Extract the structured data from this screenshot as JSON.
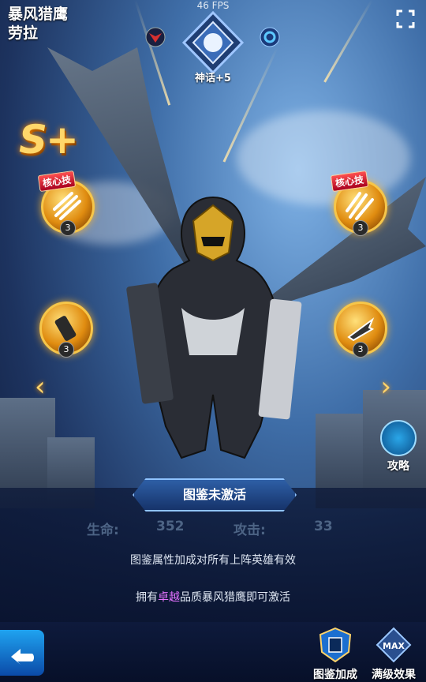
{
  "header": {
    "hero_name": "暴风猎鹰",
    "hero_real_name": "劳拉",
    "fps": "46 FPS",
    "rank_label": "神话+5"
  },
  "grade": "S+",
  "skills": {
    "tag": "核心技",
    "left_top_level": "3",
    "left_bottom_level": "3",
    "right_top_level": "3",
    "right_bottom_level": "3"
  },
  "guide_label": "攻略",
  "collection": {
    "status": "图鉴未激活",
    "hp_label": "生命:",
    "hp_value": "352",
    "atk_label": "攻击:",
    "atk_value": "33",
    "note": "图鉴属性加成对所有上阵英雄有效",
    "activate_prefix": "拥有",
    "activate_highlight": "卓越",
    "activate_suffix": "品质暴风猎鹰即可激活"
  },
  "bottom_bar": {
    "collection_bonus": "图鉴加成",
    "max_level_effect": "满级效果",
    "max_badge": "MAX"
  },
  "colors": {
    "accent_gold": "#f6c64a",
    "highlight_purple": "#e472ff",
    "panel_blue": "#16336a"
  }
}
